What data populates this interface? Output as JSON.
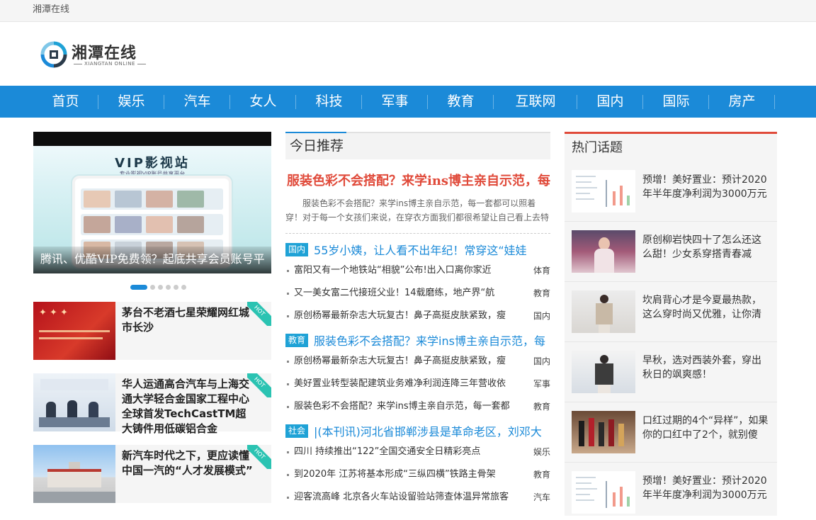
{
  "topbar": {
    "site_name": "湘潭在线"
  },
  "logo": {
    "name": "湘潭在线",
    "sub": "XIANGTAN ONLINE"
  },
  "nav": {
    "items": [
      "首页",
      "娱乐",
      "汽车",
      "女人",
      "科技",
      "军事",
      "教育",
      "互联网",
      "国内",
      "国际",
      "房产"
    ]
  },
  "slider": {
    "caption": "腾讯、优酷VIP免费领？起底共享会员账号平",
    "image_title": "VIP影视站",
    "image_sub": "专业影视VIP账号共享平台"
  },
  "hot_list": {
    "tag": "HOT",
    "items": [
      {
        "title": "茅台不老酒七星荣耀网红城市长沙"
      },
      {
        "title": "华人运通高合汽车与上海交通大学轻合金国家工程中心全球首发TechCastTM超大铸件用低碳铝合金"
      },
      {
        "title": "新汽车时代之下，更应读懂中国一汽的“人才发展模式”"
      }
    ]
  },
  "recommend": {
    "header": "今日推荐",
    "headline": "服装色彩不会搭配？来学ins博主亲自示范，每",
    "summary": "服装色彩不会搭配？来学ins博主亲自示范，每一套都可以照着穿！对于每一个女孩们来说，在穿衣方面我们都很希望让自己看上去特",
    "groups": [
      {
        "badge": "国内",
        "title": "55岁小姨，让人看不出年纪！常穿这“娃娃",
        "rows": [
          {
            "text": "富阳又有一个地铁站“相貌”公布!出入口离你家近",
            "cat": "体育"
          },
          {
            "text": "又一美女富二代接班父业！14载磨练，地产界“航",
            "cat": "教育"
          },
          {
            "text": "原创杨幂最新杂志大玩复古！鼻子高挺皮肤紧致，瘦",
            "cat": "国内"
          }
        ]
      },
      {
        "badge": "教育",
        "title": "服装色彩不会搭配？来学ins博主亲自示范，每",
        "rows": [
          {
            "text": "原创杨幂最新杂志大玩复古！鼻子高挺皮肤紧致，瘦",
            "cat": "国内"
          },
          {
            "text": "美好置业转型装配建筑业务难净利润连降三年营收依",
            "cat": "军事"
          },
          {
            "text": "服装色彩不会搭配？来学ins博主亲自示范，每一套都",
            "cat": "教育"
          }
        ]
      },
      {
        "badge": "社会",
        "title": "|(本刊讯)河北省邯郸涉县是革命老区，刘邓大",
        "rows": [
          {
            "text": "四川 持续推出“122”全国交通安全日精彩亮点",
            "cat": "娱乐"
          },
          {
            "text": "到2020年 江苏将基本形成“三纵四横”铁路主骨架",
            "cat": "教育"
          },
          {
            "text": "迎客流高峰 北京各火车站设留验站筛查体温异常旅客",
            "cat": "汽车"
          }
        ]
      }
    ]
  },
  "hot_topics": {
    "header": "热门话题",
    "items": [
      {
        "text": "预增！美好置业：预计2020年半年度净利润为3000万元"
      },
      {
        "text": "原创柳岩快四十了怎么还这么甜！少女系穿搭青春减"
      },
      {
        "text": "坎肩背心才是今夏最热款，这么穿时尚又优雅，让你清"
      },
      {
        "text": "早秋，选对西装外套，穿出秋日的飒爽感！"
      },
      {
        "text": "口红过期的4个“异样”，如果你的口红中了2个，就别傻"
      },
      {
        "text": "预增！美好置业：预计2020年半年度净利润为3000万元"
      }
    ]
  },
  "colors": {
    "nav_blue": "#1b8ad8",
    "headline_red": "#e04a3a",
    "badge_blue": "#1fa2d6",
    "hot_teal": "#2bc3b2"
  }
}
